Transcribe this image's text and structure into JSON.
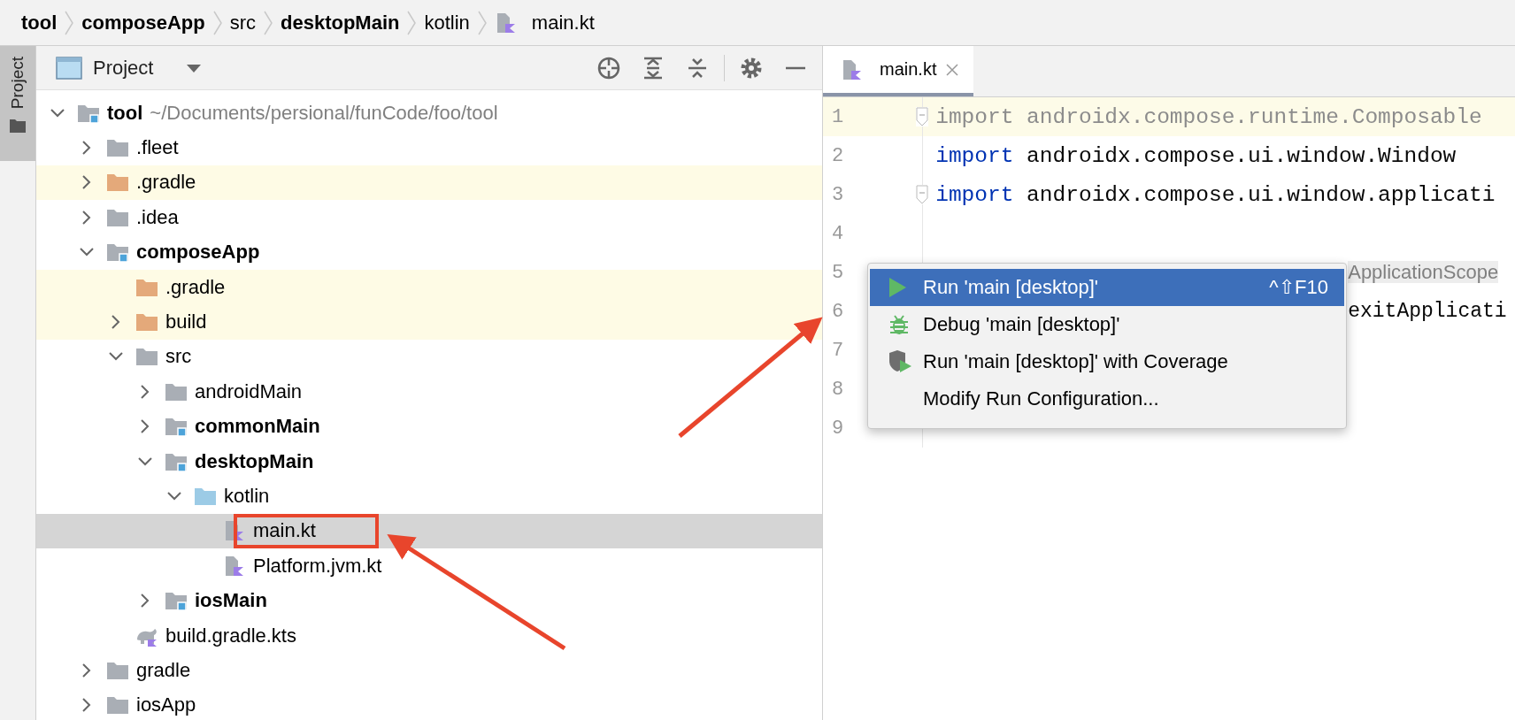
{
  "breadcrumbs": [
    {
      "label": "tool",
      "bold": true,
      "kind": "folder"
    },
    {
      "label": "composeApp",
      "bold": true,
      "kind": "folder"
    },
    {
      "label": "src",
      "bold": false,
      "kind": "folder"
    },
    {
      "label": "desktopMain",
      "bold": true,
      "kind": "folder"
    },
    {
      "label": "kotlin",
      "bold": false,
      "kind": "folder"
    },
    {
      "label": "main.kt",
      "bold": false,
      "kind": "kotlin-file"
    }
  ],
  "side_strip": {
    "tabs": [
      {
        "label": "Project",
        "selected": true
      }
    ]
  },
  "project_panel": {
    "title": "Project",
    "tree": [
      {
        "label": "tool",
        "path": "~/Documents/persional/funCode/foo/tool",
        "kind": "module",
        "bold": true,
        "expanded": true,
        "excluded": false,
        "selected": false,
        "children": [
          {
            "label": ".fleet",
            "kind": "folder",
            "bold": false,
            "expanded": false,
            "excluded": false,
            "selected": false
          },
          {
            "label": ".gradle",
            "kind": "excluded-folder",
            "bold": false,
            "expanded": false,
            "excluded": true,
            "selected": false
          },
          {
            "label": ".idea",
            "kind": "folder",
            "bold": false,
            "expanded": false,
            "excluded": false,
            "selected": false
          },
          {
            "label": "composeApp",
            "kind": "module",
            "bold": true,
            "expanded": true,
            "excluded": false,
            "selected": false,
            "children": [
              {
                "label": ".gradle",
                "kind": "excluded-folder",
                "bold": false,
                "excluded": true,
                "selected": false
              },
              {
                "label": "build",
                "kind": "excluded-folder",
                "bold": false,
                "expanded": false,
                "excluded": true,
                "selected": false
              },
              {
                "label": "src",
                "kind": "folder",
                "bold": false,
                "expanded": true,
                "excluded": false,
                "selected": false,
                "children": [
                  {
                    "label": "androidMain",
                    "kind": "folder",
                    "bold": false,
                    "expanded": false,
                    "excluded": false,
                    "selected": false
                  },
                  {
                    "label": "commonMain",
                    "kind": "module",
                    "bold": true,
                    "expanded": false,
                    "excluded": false,
                    "selected": false
                  },
                  {
                    "label": "desktopMain",
                    "kind": "module",
                    "bold": true,
                    "expanded": true,
                    "excluded": false,
                    "selected": false,
                    "children": [
                      {
                        "label": "kotlin",
                        "kind": "source-folder",
                        "bold": false,
                        "expanded": true,
                        "excluded": false,
                        "selected": false,
                        "children": [
                          {
                            "label": "main.kt",
                            "kind": "kotlin-file",
                            "bold": false,
                            "excluded": false,
                            "selected": true
                          },
                          {
                            "label": "Platform.jvm.kt",
                            "kind": "kotlin-file",
                            "bold": false,
                            "excluded": false,
                            "selected": false
                          }
                        ]
                      }
                    ]
                  },
                  {
                    "label": "iosMain",
                    "kind": "module",
                    "bold": true,
                    "expanded": false,
                    "excluded": false,
                    "selected": false
                  }
                ]
              },
              {
                "label": "build.gradle.kts",
                "kind": "gradle-file",
                "bold": false,
                "excluded": false,
                "selected": false
              }
            ]
          },
          {
            "label": "gradle",
            "kind": "folder",
            "bold": false,
            "expanded": false,
            "excluded": false,
            "selected": false
          },
          {
            "label": "iosApp",
            "kind": "folder",
            "bold": false,
            "expanded": false,
            "excluded": false,
            "selected": false
          }
        ]
      }
    ]
  },
  "editor": {
    "tabs": [
      {
        "label": "main.kt",
        "selected": true
      }
    ],
    "lines": [
      {
        "number": "1",
        "current": true,
        "covered": false,
        "fold": true,
        "segments": [
          {
            "kind": "unused",
            "text": "import androidx.compose.runtime.Composable"
          }
        ]
      },
      {
        "number": "2",
        "current": false,
        "covered": false,
        "fold": false,
        "segments": [
          {
            "kind": "keyword",
            "text": "import"
          },
          {
            "kind": "plain",
            "text": " androidx.compose.ui.window.Window"
          }
        ]
      },
      {
        "number": "3",
        "current": false,
        "covered": false,
        "fold": true,
        "segments": [
          {
            "kind": "keyword",
            "text": "import"
          },
          {
            "kind": "plain",
            "text": " androidx.compose.ui.window.applicati"
          }
        ]
      },
      {
        "number": "4",
        "current": false,
        "fold": false
      },
      {
        "number": "5",
        "current": false,
        "covered": true,
        "segments": [
          {
            "kind": "hint",
            "text": "ApplicationScope"
          }
        ]
      },
      {
        "number": "6",
        "current": false,
        "covered": true,
        "segments": [
          {
            "kind": "plain",
            "text": "exitApplicati"
          }
        ]
      },
      {
        "number": "7",
        "current": false
      },
      {
        "number": "8",
        "current": false
      },
      {
        "number": "9",
        "current": false,
        "fold": false
      }
    ]
  },
  "context_menu": {
    "items": [
      {
        "kind": "run",
        "label": "Run 'main [desktop]'",
        "shortcut": "^⇧F10",
        "selected": true
      },
      {
        "kind": "debug",
        "label": "Debug 'main [desktop]'",
        "selected": false
      },
      {
        "kind": "coverage",
        "label": "Run 'main [desktop]' with Coverage",
        "selected": false
      },
      {
        "kind": "plain",
        "label": "Modify Run Configuration...",
        "selected": false
      }
    ]
  }
}
